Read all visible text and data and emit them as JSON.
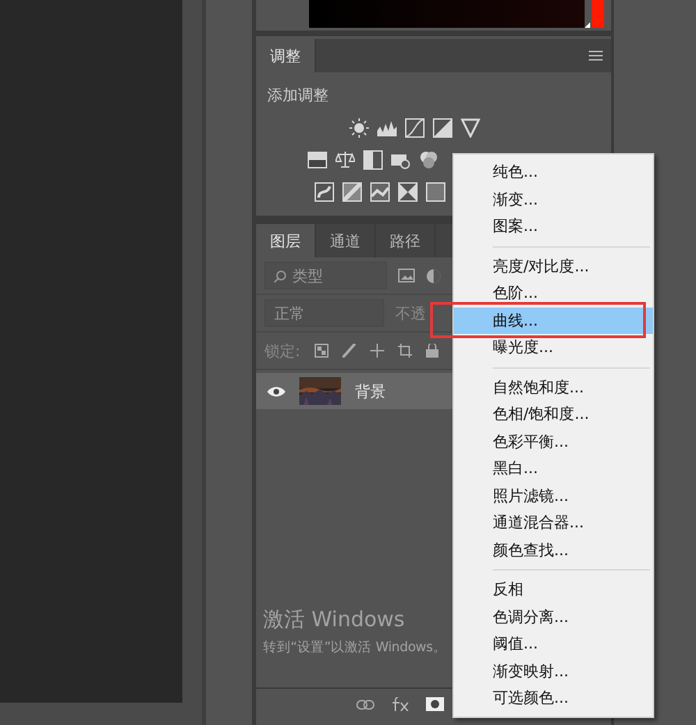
{
  "adjustments_panel": {
    "tab": "调整",
    "title": "添加调整"
  },
  "layers_panel": {
    "tabs": [
      {
        "label": "图层",
        "selected": true
      },
      {
        "label": "通道",
        "selected": false
      },
      {
        "label": "路径",
        "selected": false
      }
    ],
    "filter": {
      "placeholder": "类型"
    },
    "blend_mode": "正常",
    "opacity_label": "不透",
    "lock_label": "锁定:",
    "layers": [
      {
        "name": "背景",
        "visible": true,
        "selected": true
      }
    ]
  },
  "context_menu": {
    "groups": [
      [
        {
          "label": "纯色...",
          "selected": false
        },
        {
          "label": "渐变...",
          "selected": false
        },
        {
          "label": "图案...",
          "selected": false
        }
      ],
      [
        {
          "label": "亮度/对比度...",
          "selected": false
        },
        {
          "label": "色阶...",
          "selected": false
        },
        {
          "label": "曲线...",
          "selected": true
        },
        {
          "label": "曝光度...",
          "selected": false
        }
      ],
      [
        {
          "label": "自然饱和度...",
          "selected": false
        },
        {
          "label": "色相/饱和度...",
          "selected": false
        },
        {
          "label": "色彩平衡...",
          "selected": false
        },
        {
          "label": "黑白...",
          "selected": false
        },
        {
          "label": "照片滤镜...",
          "selected": false
        },
        {
          "label": "通道混合器...",
          "selected": false
        },
        {
          "label": "颜色查找...",
          "selected": false
        }
      ],
      [
        {
          "label": "反相",
          "selected": false
        },
        {
          "label": "色调分离...",
          "selected": false
        },
        {
          "label": "阈值...",
          "selected": false
        },
        {
          "label": "渐变映射...",
          "selected": false
        },
        {
          "label": "可选颜色...",
          "selected": false
        }
      ]
    ]
  },
  "activation_notice": {
    "title": "激活 Windows",
    "message": "转到“设置”以激活 Windows。"
  }
}
